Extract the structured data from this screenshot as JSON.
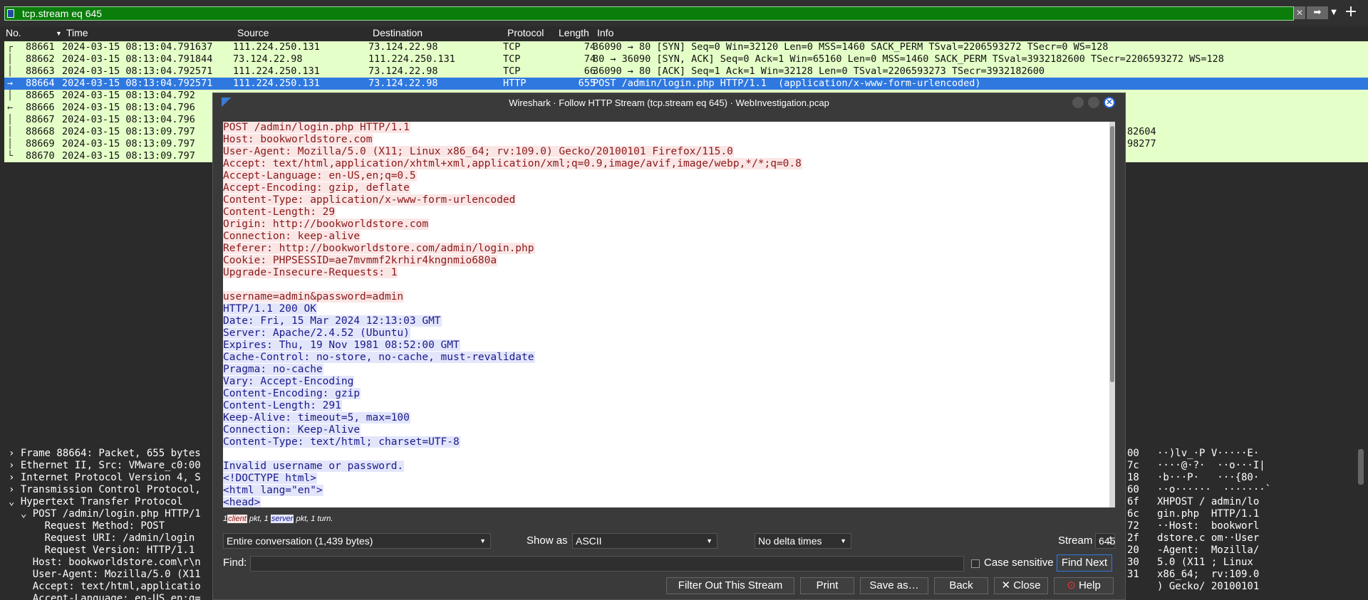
{
  "filter": {
    "value": "tcp.stream eq 645"
  },
  "packet_list": {
    "headers": [
      "No.",
      "Time",
      "Source",
      "Destination",
      "Protocol",
      "Length",
      "Info"
    ],
    "rows": [
      {
        "no": "88661",
        "time": "2024-03-15 08:13:04.791637",
        "src": "111.224.250.131",
        "dst": "73.124.22.98",
        "proto": "TCP",
        "len": "74",
        "info": "36090 → 80 [SYN] Seq=0 Win=32120 Len=0 MSS=1460 SACK_PERM TSval=2206593272 TSecr=0 WS=128"
      },
      {
        "no": "88662",
        "time": "2024-03-15 08:13:04.791844",
        "src": "73.124.22.98",
        "dst": "111.224.250.131",
        "proto": "TCP",
        "len": "74",
        "info": "80 → 36090 [SYN, ACK] Seq=0 Ack=1 Win=65160 Len=0 MSS=1460 SACK_PERM TSval=3932182600 TSecr=2206593272 WS=128"
      },
      {
        "no": "88663",
        "time": "2024-03-15 08:13:04.792571",
        "src": "111.224.250.131",
        "dst": "73.124.22.98",
        "proto": "TCP",
        "len": "66",
        "info": "36090 → 80 [ACK] Seq=1 Ack=1 Win=32128 Len=0 TSval=2206593273 TSecr=3932182600"
      },
      {
        "no": "88664",
        "time": "2024-03-15 08:13:04.792571",
        "src": "111.224.250.131",
        "dst": "73.124.22.98",
        "proto": "HTTP",
        "len": "655",
        "info": "POST /admin/login.php HTTP/1.1  (application/x-www-form-urlencoded)",
        "selected": true
      },
      {
        "no": "88665",
        "time": "2024-03-15 08:13:04.792",
        "src": "",
        "dst": "",
        "proto": "",
        "len": "",
        "info": ""
      },
      {
        "no": "88666",
        "time": "2024-03-15 08:13:04.796",
        "src": "",
        "dst": "",
        "proto": "",
        "len": "",
        "info": ""
      },
      {
        "no": "88667",
        "time": "2024-03-15 08:13:04.796",
        "src": "",
        "dst": "",
        "proto": "",
        "len": "",
        "info": ""
      },
      {
        "no": "88668",
        "time": "2024-03-15 08:13:09.797",
        "src": "",
        "dst": "",
        "proto": "",
        "len": "",
        "info": "",
        "tail": "82604"
      },
      {
        "no": "88669",
        "time": "2024-03-15 08:13:09.797",
        "src": "",
        "dst": "",
        "proto": "",
        "len": "",
        "info": "",
        "tail": "98277"
      },
      {
        "no": "88670",
        "time": "2024-03-15 08:13:09.797",
        "src": "",
        "dst": "",
        "proto": "",
        "len": "",
        "info": ""
      }
    ]
  },
  "details": {
    "lines": [
      "› Frame 88664: Packet, 655 bytes",
      "› Ethernet II, Src: VMware_c0:00",
      "› Internet Protocol Version 4, S",
      "› Transmission Control Protocol,",
      "⌄ Hypertext Transfer Protocol",
      "  ⌄ POST /admin/login.php HTTP/1",
      "      Request Method: POST",
      "      Request URI: /admin/login",
      "      Request Version: HTTP/1.1",
      "    Host: bookworldstore.com\\r\\n",
      "    User-Agent: Mozilla/5.0 (X11",
      "    Accept: text/html,applicatio",
      "    Accept-Language: en-US,en;q="
    ],
    "hex_offsets": [
      "00",
      "7c",
      "18",
      "60",
      "6f",
      "6c",
      "72",
      "2f",
      "20",
      "30",
      "31"
    ],
    "ascii": [
      "··)lv_·P V·····E·",
      "····@·?·  ··o···I|",
      "·b···P·   ···{80·",
      "··o······  ·······`",
      "XHPOST / admin/lo",
      "gin.php  HTTP/1.1",
      "··Host:  bookworl",
      "dstore.c om··User",
      "-Agent:  Mozilla/",
      "5.0 (X11 ; Linux",
      "x86_64;  rv:109.0",
      ") Gecko/ 20100101"
    ]
  },
  "dialog": {
    "title": "Wireshark · Follow HTTP Stream (tcp.stream eq 645) · WebInvestigation.pcap",
    "client_lines": [
      "POST /admin/login.php HTTP/1.1",
      "Host: bookworldstore.com",
      "User-Agent: Mozilla/5.0 (X11; Linux x86_64; rv:109.0) Gecko/20100101 Firefox/115.0",
      "Accept: text/html,application/xhtml+xml,application/xml;q=0.9,image/avif,image/webp,*/*;q=0.8",
      "Accept-Language: en-US,en;q=0.5",
      "Accept-Encoding: gzip, deflate",
      "Content-Type: application/x-www-form-urlencoded",
      "Content-Length: 29",
      "Origin: http://bookworldstore.com",
      "Connection: keep-alive",
      "Referer: http://bookworldstore.com/admin/login.php",
      "Cookie: PHPSESSID=ae7mvmmf2krhir4kngnmio680a",
      "Upgrade-Insecure-Requests: 1"
    ],
    "client_body": "username=admin&password=admin",
    "server_lines": [
      "HTTP/1.1 200 OK",
      "Date: Fri, 15 Mar 2024 12:13:03 GMT",
      "Server: Apache/2.4.52 (Ubuntu)",
      "Expires: Thu, 19 Nov 1981 08:52:00 GMT",
      "Cache-Control: no-store, no-cache, must-revalidate",
      "Pragma: no-cache",
      "Vary: Accept-Encoding",
      "Content-Encoding: gzip",
      "Content-Length: 291",
      "Keep-Alive: timeout=5, max=100",
      "Connection: Keep-Alive",
      "Content-Type: text/html; charset=UTF-8"
    ],
    "server_body": [
      "Invalid username or password.",
      "<!DOCTYPE html>",
      "<html lang=\"en\">",
      "<head>"
    ],
    "status": {
      "n1": "1",
      "client": "client",
      "pkt1": " pkt, 1 ",
      "server": "server",
      "pkt2": " pkt, 1 turn."
    },
    "conversation": "Entire conversation (1,439 bytes)",
    "show_as_label": "Show as",
    "show_as": "ASCII",
    "delta": "No delta times",
    "stream_label": "Stream",
    "stream_value": "645",
    "find_label": "Find:",
    "case_sensitive": "Case sensitive",
    "find_next": "Find Next",
    "buttons": {
      "filter_out": "Filter Out This Stream",
      "print": "Print",
      "save_as": "Save as…",
      "back": "Back",
      "close": "✕ Close",
      "help": "Help"
    }
  }
}
